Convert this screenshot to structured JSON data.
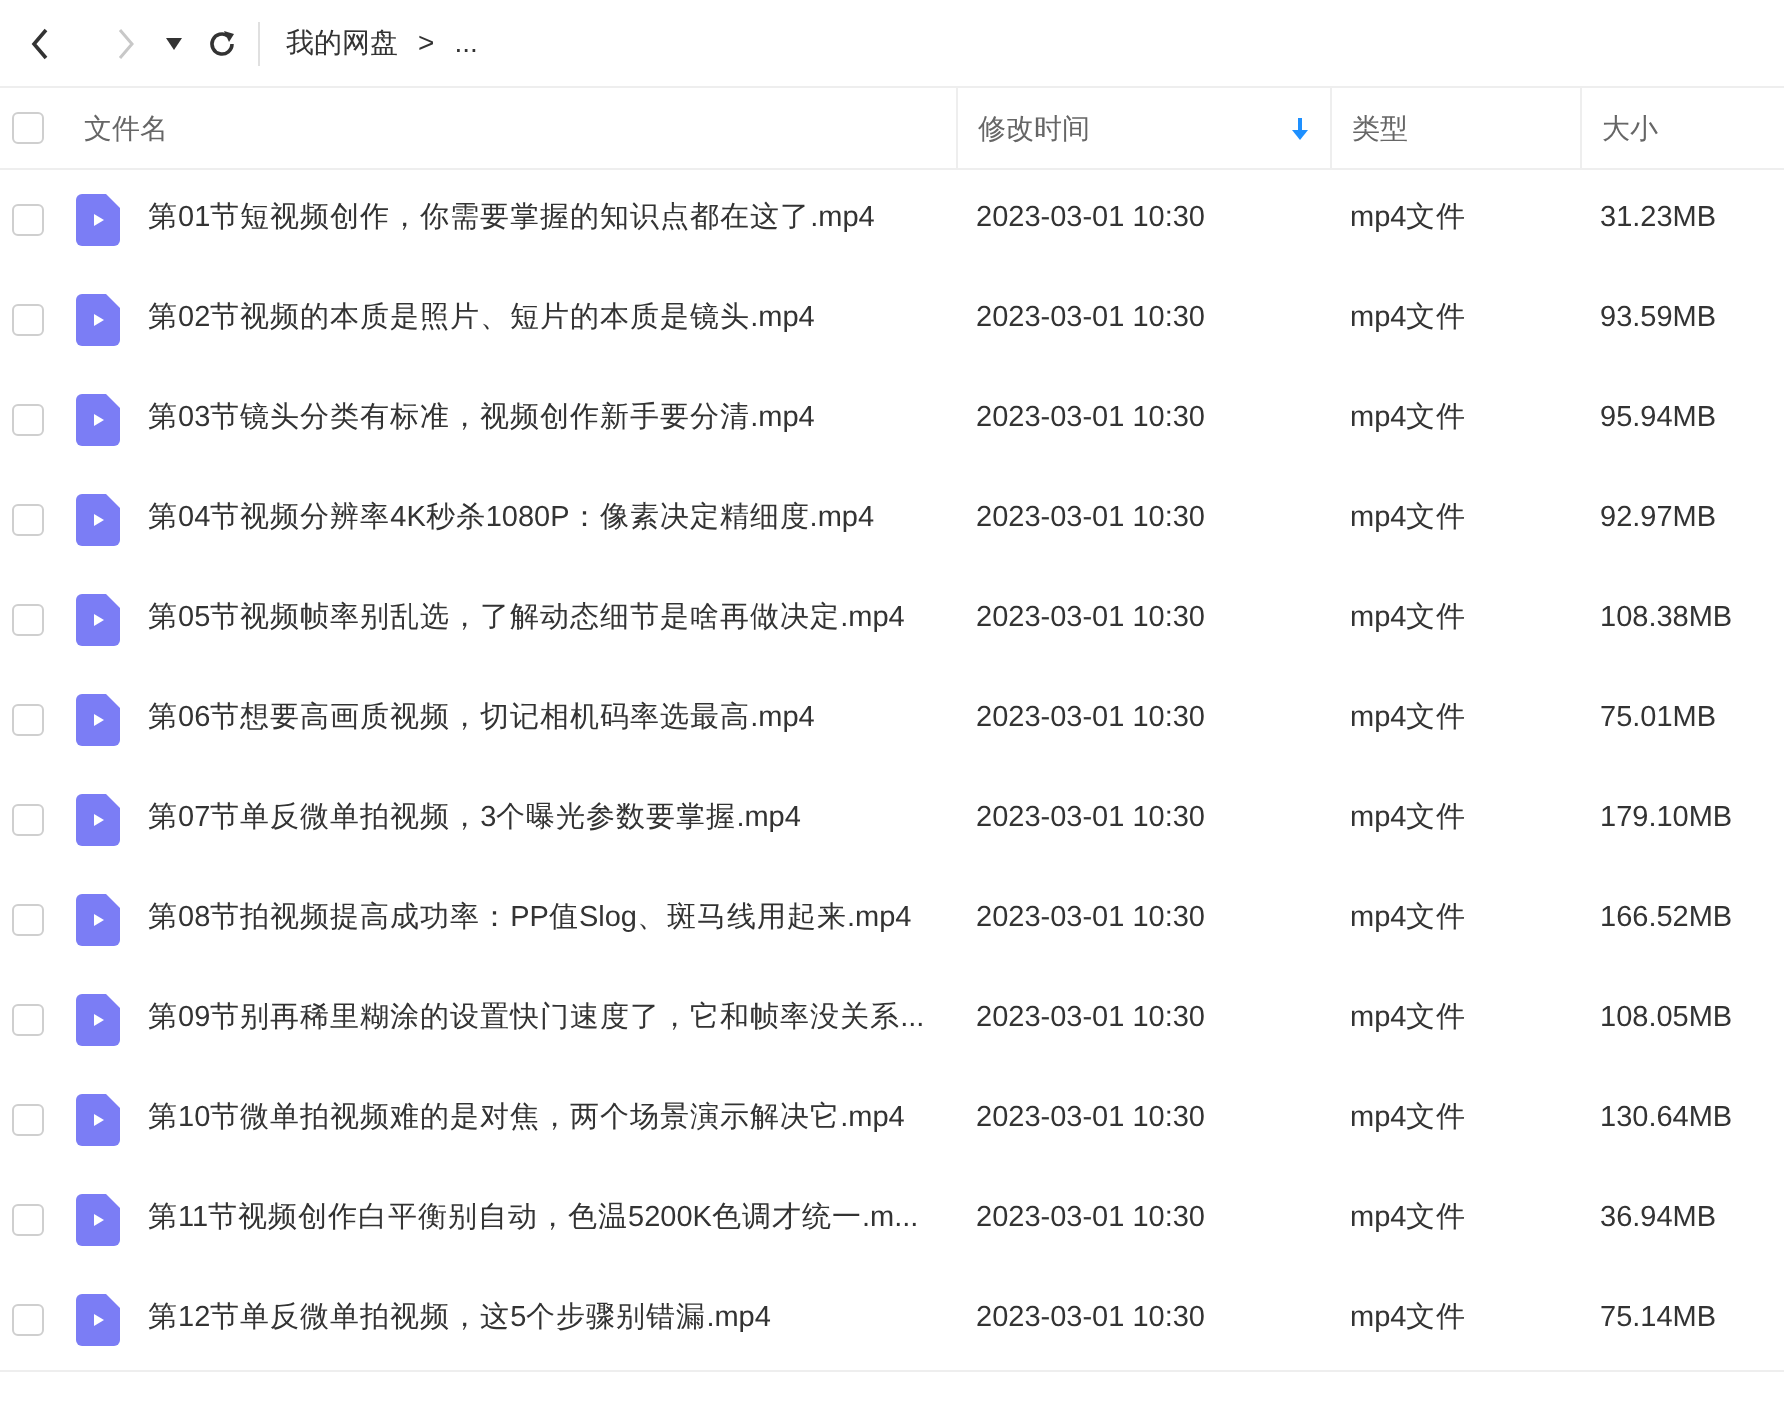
{
  "toolbar": {
    "back": {
      "disabled": false
    },
    "forward": {
      "disabled": true
    },
    "breadcrumb": [
      "我的网盘",
      ">",
      "..."
    ]
  },
  "table": {
    "select_all": {
      "checked": false
    },
    "columns": [
      {
        "label": "文件名",
        "sorted": false
      },
      {
        "label": "修改时间",
        "sorted": true
      },
      {
        "label": "类型",
        "sorted": false
      },
      {
        "label": "大小",
        "sorted": false
      }
    ],
    "rows": [
      {
        "checked": false,
        "name": "第01节短视频创作，你需要掌握的知识点都在这了.mp4",
        "modified": "2023-03-01 10:30",
        "type": "mp4文件",
        "size": "31.23MB"
      },
      {
        "checked": false,
        "name": "第02节视频的本质是照片、短片的本质是镜头.mp4",
        "modified": "2023-03-01 10:30",
        "type": "mp4文件",
        "size": "93.59MB"
      },
      {
        "checked": false,
        "name": "第03节镜头分类有标准，视频创作新手要分清.mp4",
        "modified": "2023-03-01 10:30",
        "type": "mp4文件",
        "size": "95.94MB"
      },
      {
        "checked": false,
        "name": "第04节视频分辨率4K秒杀1080P：像素决定精细度.mp4",
        "modified": "2023-03-01 10:30",
        "type": "mp4文件",
        "size": "92.97MB"
      },
      {
        "checked": false,
        "name": "第05节视频帧率别乱选，了解动态细节是啥再做决定.mp4",
        "modified": "2023-03-01 10:30",
        "type": "mp4文件",
        "size": "108.38MB"
      },
      {
        "checked": false,
        "name": "第06节想要高画质视频，切记相机码率选最高.mp4",
        "modified": "2023-03-01 10:30",
        "type": "mp4文件",
        "size": "75.01MB"
      },
      {
        "checked": false,
        "name": "第07节单反微单拍视频，3个曝光参数要掌握.mp4",
        "modified": "2023-03-01 10:30",
        "type": "mp4文件",
        "size": "179.10MB"
      },
      {
        "checked": false,
        "name": "第08节拍视频提高成功率：PP值Slog、斑马线用起来.mp4",
        "modified": "2023-03-01 10:30",
        "type": "mp4文件",
        "size": "166.52MB"
      },
      {
        "checked": false,
        "name": "第09节别再稀里糊涂的设置快门速度了，它和帧率没关系...",
        "modified": "2023-03-01 10:30",
        "type": "mp4文件",
        "size": "108.05MB"
      },
      {
        "checked": false,
        "name": "第10节微单拍视频难的是对焦，两个场景演示解决它.mp4",
        "modified": "2023-03-01 10:30",
        "type": "mp4文件",
        "size": "130.64MB"
      },
      {
        "checked": false,
        "name": "第11节视频创作白平衡别自动，色温5200K色调才统一.m...",
        "modified": "2023-03-01 10:30",
        "type": "mp4文件",
        "size": "36.94MB"
      },
      {
        "checked": false,
        "name": "第12节单反微单拍视频，这5个步骤别错漏.mp4",
        "modified": "2023-03-01 10:30",
        "type": "mp4文件",
        "size": "75.14MB"
      }
    ]
  }
}
